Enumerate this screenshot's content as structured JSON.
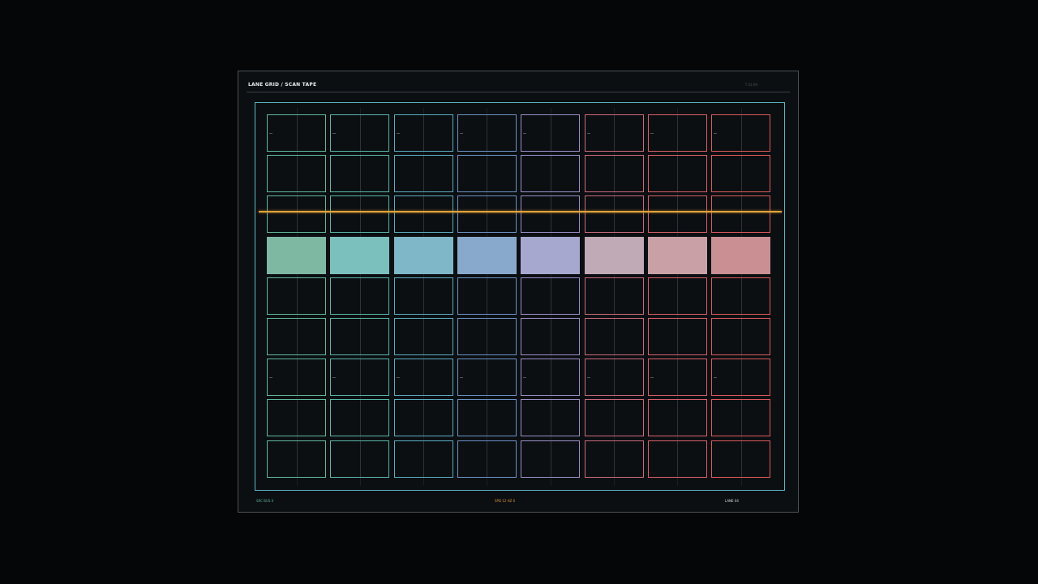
{
  "header": {
    "title": "LANE GRID / SCAN TAPE",
    "meta": "T 01:09"
  },
  "footer": {
    "left": "SRC BUS 0",
    "mid": "SPD 12 HZ 0",
    "right": "LANE 04"
  },
  "grid": {
    "columns": 8,
    "rows": 9,
    "scan_row": 3,
    "lane_colors": [
      "#5fb89a",
      "#59b5a8",
      "#5aacc0",
      "#6b92c6",
      "#9a8fc8",
      "#c96a7c",
      "#d66068",
      "#dc5a5a"
    ],
    "scan_fill_colors": [
      "#7fb8a2",
      "#7cc0bd",
      "#7fb6c8",
      "#88a9cb",
      "#a7a8cf",
      "#bfaab5",
      "#c9a0a6",
      "#c98f93"
    ]
  },
  "colors": {
    "frame": "#5cb7c2",
    "scan_line": "#e0a338",
    "background": "#050607",
    "panel": "#0c0f12"
  }
}
